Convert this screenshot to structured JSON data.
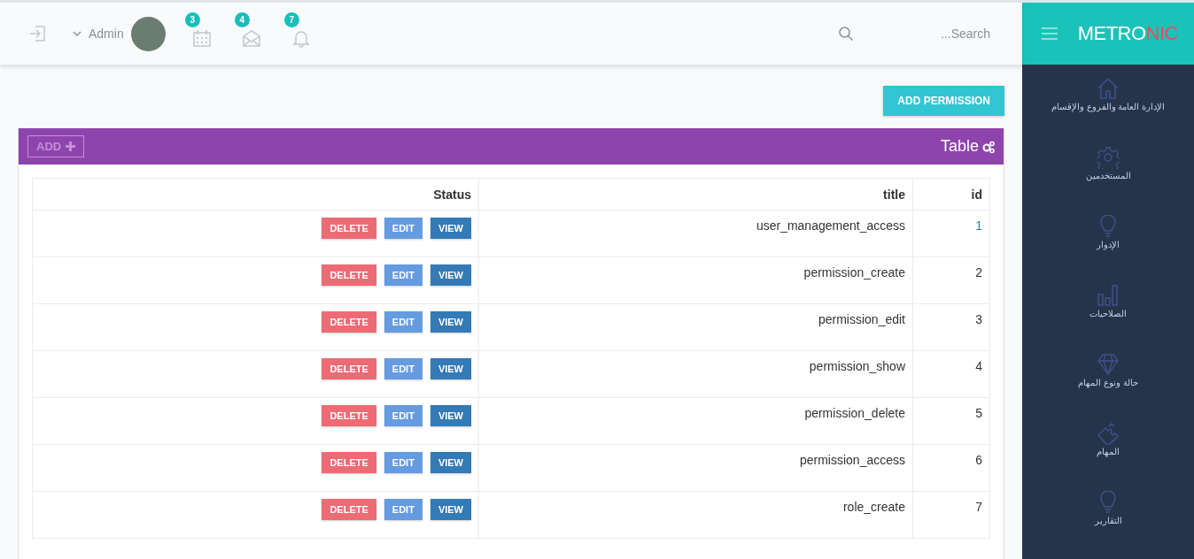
{
  "topbar": {
    "user": {
      "name": "Admin"
    },
    "badges": [
      {
        "kind": "calendar",
        "count": "3"
      },
      {
        "kind": "mail",
        "count": "4"
      },
      {
        "kind": "bell",
        "count": "7"
      }
    ],
    "search": {
      "placeholder": "...Search"
    }
  },
  "brand": {
    "part_1": "METRO",
    "part_2": "NIC"
  },
  "sidebar": {
    "items": [
      {
        "label": "الإدارة العامة والفروع والإقسام"
      },
      {
        "label": "المستخدمين"
      },
      {
        "label": "الإدوار"
      },
      {
        "label": "الصلاحيات"
      },
      {
        "label": "حالة ونوع المهام"
      },
      {
        "label": "المهام"
      },
      {
        "label": "التقارير"
      }
    ]
  },
  "add_permission_button": "ADD PERMISSION",
  "panel": {
    "title": "Table",
    "add_button": "ADD",
    "table": {
      "columns": [
        "Status",
        "title",
        "id"
      ],
      "rows": [
        {
          "actions": [
            "DELETE",
            "EDIT",
            "VIEW"
          ],
          "title": "user_management_access",
          "id": "1",
          "hovered": true
        },
        {
          "actions": [
            "DELETE",
            "EDIT",
            "VIEW"
          ],
          "title": "permission_create",
          "id": "2",
          "hovered": false
        },
        {
          "actions": [
            "DELETE",
            "EDIT",
            "VIEW"
          ],
          "title": "permission_edit",
          "id": "3",
          "hovered": false
        },
        {
          "actions": [
            "DELETE",
            "EDIT",
            "VIEW"
          ],
          "title": "permission_show",
          "id": "4",
          "hovered": false
        },
        {
          "actions": [
            "DELETE",
            "EDIT",
            "VIEW"
          ],
          "title": "permission_delete",
          "id": "5",
          "hovered": false
        },
        {
          "actions": [
            "DELETE",
            "EDIT",
            "VIEW"
          ],
          "title": "permission_access",
          "id": "6",
          "hovered": false
        },
        {
          "actions": [
            "DELETE",
            "EDIT",
            "VIEW"
          ],
          "title": "role_create",
          "id": "7",
          "hovered": false
        }
      ]
    }
  }
}
